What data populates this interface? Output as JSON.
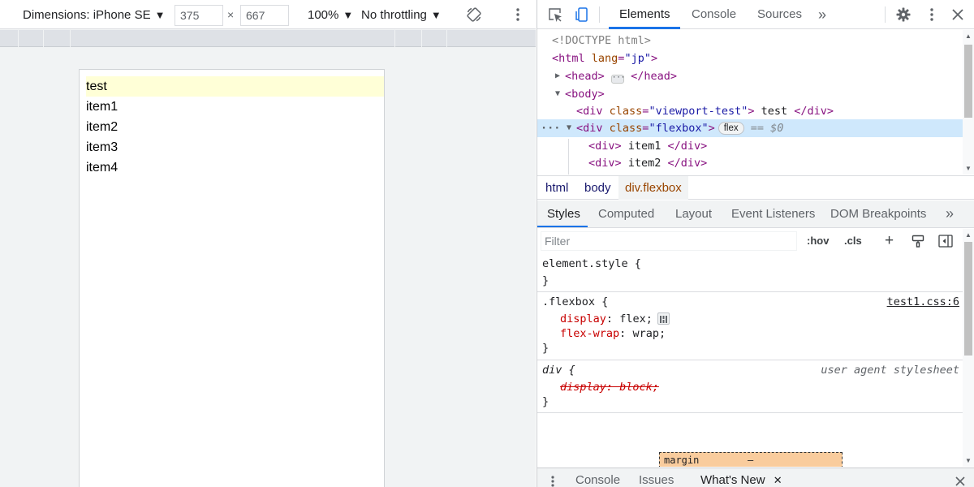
{
  "device_toolbar": {
    "dimensions_label": "Dimensions: iPhone SE",
    "width": "375",
    "times": "×",
    "height": "667",
    "zoom": "100%",
    "throttling": "No throttling",
    "caret": "▼"
  },
  "page_content": {
    "banner": "test",
    "items": [
      "item1",
      "item2",
      "item3",
      "item4"
    ]
  },
  "devtools_tabs": {
    "elements": "Elements",
    "console": "Console",
    "sources": "Sources",
    "more": "»"
  },
  "dom_tree": {
    "doctype": "<!DOCTYPE html>",
    "html_open": "<html",
    "html_lang_attr": "lang",
    "html_lang_val": "\"jp\"",
    "head_open": "<head>",
    "head_close": "</head>",
    "body_open": "<body>",
    "div_open": "<div",
    "class_attr": "class",
    "viewport_class_val": "\"viewport-test\"",
    "viewport_text": " test ",
    "div_close": "</div>",
    "flexbox_class_val": "\"flexbox\"",
    "flex_pill": "flex",
    "selected_marker": "== $0",
    "item1_text": " item1 ",
    "item2_text": " item2 ",
    "div_tag": "<div>"
  },
  "breadcrumb": [
    "html",
    "body",
    "div.flexbox"
  ],
  "styles_tabs": [
    "Styles",
    "Computed",
    "Layout",
    "Event Listeners",
    "DOM Breakpoints",
    "»"
  ],
  "filter": {
    "placeholder": "Filter",
    "hov": ":hov",
    "cls": ".cls",
    "plus": "+"
  },
  "styles": {
    "element_style_selector": "element.style {",
    "close_brace": "}",
    "flexbox_selector": ".flexbox {",
    "flexbox_source": "test1.css:6",
    "prop_display": "display",
    "val_flex": "flex;",
    "prop_flex_wrap": "flex-wrap",
    "val_wrap": "wrap;",
    "div_selector": "div {",
    "ua_source": "user agent stylesheet",
    "overridden_decl": "display: block;",
    "colon": ":"
  },
  "box_model": {
    "label": "margin",
    "value": "–"
  },
  "drawer": {
    "console": "Console",
    "issues": "Issues",
    "whats_new": "What's New",
    "close_tab": "✕"
  },
  "colors": {
    "accent": "#1a73e8",
    "selected_row": "#cfe8fc",
    "highlight_banner": "#ffffd7",
    "margin_box": "#f9cc9d"
  }
}
